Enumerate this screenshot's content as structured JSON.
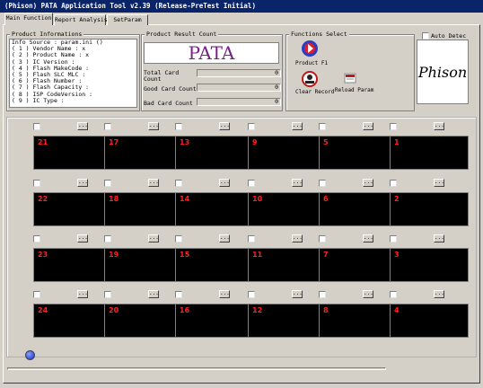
{
  "window": {
    "title": "(Phison) PATA Application Tool v2.39  (Release-PreTest Initial)"
  },
  "tabs": [
    {
      "label": "Main Function",
      "active": true
    },
    {
      "label": "Report Analysis",
      "active": false
    },
    {
      "label": "SetParam",
      "active": false
    }
  ],
  "product_info": {
    "label": "Product Informations",
    "lines": [
      "Info Source : param.ini ()",
      "( 1 ) Vendor Name : x",
      "( 2 ) Product Name : x",
      "( 3 ) IC Version :",
      "( 4 ) Flash MakeCode :",
      "( 5 ) Flash SLC MLC :",
      "( 6 ) Flash Number :",
      "( 7 ) Flash Capacity :",
      "( 8 ) ISP CodeVersion :",
      "( 9 ) IC Type :"
    ]
  },
  "result": {
    "label": "Product Result Count",
    "display": "PATA",
    "total_label": "Total Card Count",
    "total_value": "0",
    "good_label": "Good Card Count",
    "good_value": "0",
    "bad_label": "Bad Card Count",
    "bad_value": "0"
  },
  "functions": {
    "label": "Functions Select",
    "auto_detect": "Auto Detec",
    "product_label": "Product F1",
    "clear_label": "Clear Record",
    "reload_label": "Reload Param"
  },
  "logo": {
    "text": "Phison"
  },
  "slot_button_label": "...",
  "slots": [
    {
      "number": "21"
    },
    {
      "number": "17"
    },
    {
      "number": "13"
    },
    {
      "number": "9"
    },
    {
      "number": "5"
    },
    {
      "number": "1"
    },
    {
      "number": "22"
    },
    {
      "number": "18"
    },
    {
      "number": "14"
    },
    {
      "number": "10"
    },
    {
      "number": "6"
    },
    {
      "number": "2"
    },
    {
      "number": "23"
    },
    {
      "number": "19"
    },
    {
      "number": "15"
    },
    {
      "number": "11"
    },
    {
      "number": "7"
    },
    {
      "number": "3"
    },
    {
      "number": "24"
    },
    {
      "number": "20"
    },
    {
      "number": "16"
    },
    {
      "number": "12"
    },
    {
      "number": "8"
    },
    {
      "number": "4"
    }
  ],
  "colors": {
    "titlebar": "#0a246a",
    "slot_screen": "#000000",
    "slot_number": "#ff2020",
    "pata_text": "#7a1f8a"
  }
}
